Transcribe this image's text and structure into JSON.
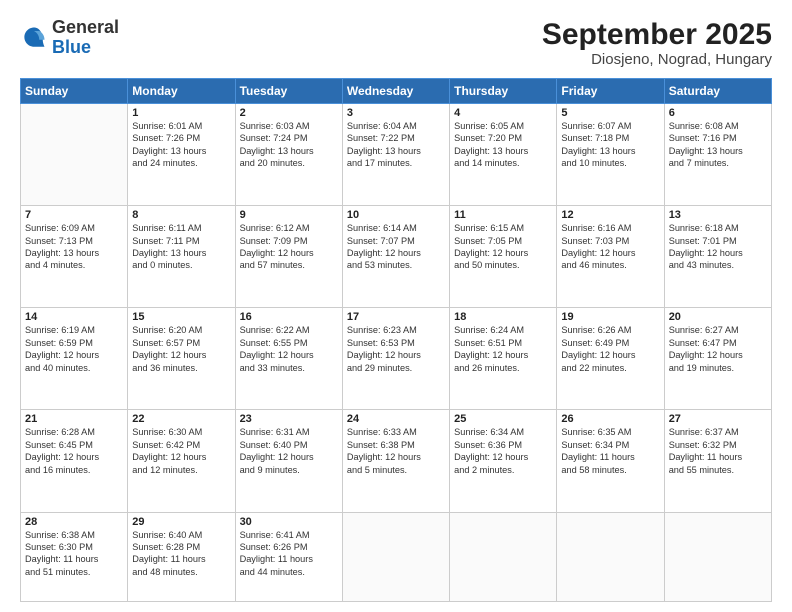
{
  "header": {
    "logo_general": "General",
    "logo_blue": "Blue",
    "title": "September 2025",
    "subtitle": "Diosjeno, Nograd, Hungary"
  },
  "days_of_week": [
    "Sunday",
    "Monday",
    "Tuesday",
    "Wednesday",
    "Thursday",
    "Friday",
    "Saturday"
  ],
  "weeks": [
    [
      {
        "day": "",
        "info": ""
      },
      {
        "day": "1",
        "info": "Sunrise: 6:01 AM\nSunset: 7:26 PM\nDaylight: 13 hours\nand 24 minutes."
      },
      {
        "day": "2",
        "info": "Sunrise: 6:03 AM\nSunset: 7:24 PM\nDaylight: 13 hours\nand 20 minutes."
      },
      {
        "day": "3",
        "info": "Sunrise: 6:04 AM\nSunset: 7:22 PM\nDaylight: 13 hours\nand 17 minutes."
      },
      {
        "day": "4",
        "info": "Sunrise: 6:05 AM\nSunset: 7:20 PM\nDaylight: 13 hours\nand 14 minutes."
      },
      {
        "day": "5",
        "info": "Sunrise: 6:07 AM\nSunset: 7:18 PM\nDaylight: 13 hours\nand 10 minutes."
      },
      {
        "day": "6",
        "info": "Sunrise: 6:08 AM\nSunset: 7:16 PM\nDaylight: 13 hours\nand 7 minutes."
      }
    ],
    [
      {
        "day": "7",
        "info": "Sunrise: 6:09 AM\nSunset: 7:13 PM\nDaylight: 13 hours\nand 4 minutes."
      },
      {
        "day": "8",
        "info": "Sunrise: 6:11 AM\nSunset: 7:11 PM\nDaylight: 13 hours\nand 0 minutes."
      },
      {
        "day": "9",
        "info": "Sunrise: 6:12 AM\nSunset: 7:09 PM\nDaylight: 12 hours\nand 57 minutes."
      },
      {
        "day": "10",
        "info": "Sunrise: 6:14 AM\nSunset: 7:07 PM\nDaylight: 12 hours\nand 53 minutes."
      },
      {
        "day": "11",
        "info": "Sunrise: 6:15 AM\nSunset: 7:05 PM\nDaylight: 12 hours\nand 50 minutes."
      },
      {
        "day": "12",
        "info": "Sunrise: 6:16 AM\nSunset: 7:03 PM\nDaylight: 12 hours\nand 46 minutes."
      },
      {
        "day": "13",
        "info": "Sunrise: 6:18 AM\nSunset: 7:01 PM\nDaylight: 12 hours\nand 43 minutes."
      }
    ],
    [
      {
        "day": "14",
        "info": "Sunrise: 6:19 AM\nSunset: 6:59 PM\nDaylight: 12 hours\nand 40 minutes."
      },
      {
        "day": "15",
        "info": "Sunrise: 6:20 AM\nSunset: 6:57 PM\nDaylight: 12 hours\nand 36 minutes."
      },
      {
        "day": "16",
        "info": "Sunrise: 6:22 AM\nSunset: 6:55 PM\nDaylight: 12 hours\nand 33 minutes."
      },
      {
        "day": "17",
        "info": "Sunrise: 6:23 AM\nSunset: 6:53 PM\nDaylight: 12 hours\nand 29 minutes."
      },
      {
        "day": "18",
        "info": "Sunrise: 6:24 AM\nSunset: 6:51 PM\nDaylight: 12 hours\nand 26 minutes."
      },
      {
        "day": "19",
        "info": "Sunrise: 6:26 AM\nSunset: 6:49 PM\nDaylight: 12 hours\nand 22 minutes."
      },
      {
        "day": "20",
        "info": "Sunrise: 6:27 AM\nSunset: 6:47 PM\nDaylight: 12 hours\nand 19 minutes."
      }
    ],
    [
      {
        "day": "21",
        "info": "Sunrise: 6:28 AM\nSunset: 6:45 PM\nDaylight: 12 hours\nand 16 minutes."
      },
      {
        "day": "22",
        "info": "Sunrise: 6:30 AM\nSunset: 6:42 PM\nDaylight: 12 hours\nand 12 minutes."
      },
      {
        "day": "23",
        "info": "Sunrise: 6:31 AM\nSunset: 6:40 PM\nDaylight: 12 hours\nand 9 minutes."
      },
      {
        "day": "24",
        "info": "Sunrise: 6:33 AM\nSunset: 6:38 PM\nDaylight: 12 hours\nand 5 minutes."
      },
      {
        "day": "25",
        "info": "Sunrise: 6:34 AM\nSunset: 6:36 PM\nDaylight: 12 hours\nand 2 minutes."
      },
      {
        "day": "26",
        "info": "Sunrise: 6:35 AM\nSunset: 6:34 PM\nDaylight: 11 hours\nand 58 minutes."
      },
      {
        "day": "27",
        "info": "Sunrise: 6:37 AM\nSunset: 6:32 PM\nDaylight: 11 hours\nand 55 minutes."
      }
    ],
    [
      {
        "day": "28",
        "info": "Sunrise: 6:38 AM\nSunset: 6:30 PM\nDaylight: 11 hours\nand 51 minutes."
      },
      {
        "day": "29",
        "info": "Sunrise: 6:40 AM\nSunset: 6:28 PM\nDaylight: 11 hours\nand 48 minutes."
      },
      {
        "day": "30",
        "info": "Sunrise: 6:41 AM\nSunset: 6:26 PM\nDaylight: 11 hours\nand 44 minutes."
      },
      {
        "day": "",
        "info": ""
      },
      {
        "day": "",
        "info": ""
      },
      {
        "day": "",
        "info": ""
      },
      {
        "day": "",
        "info": ""
      }
    ]
  ]
}
